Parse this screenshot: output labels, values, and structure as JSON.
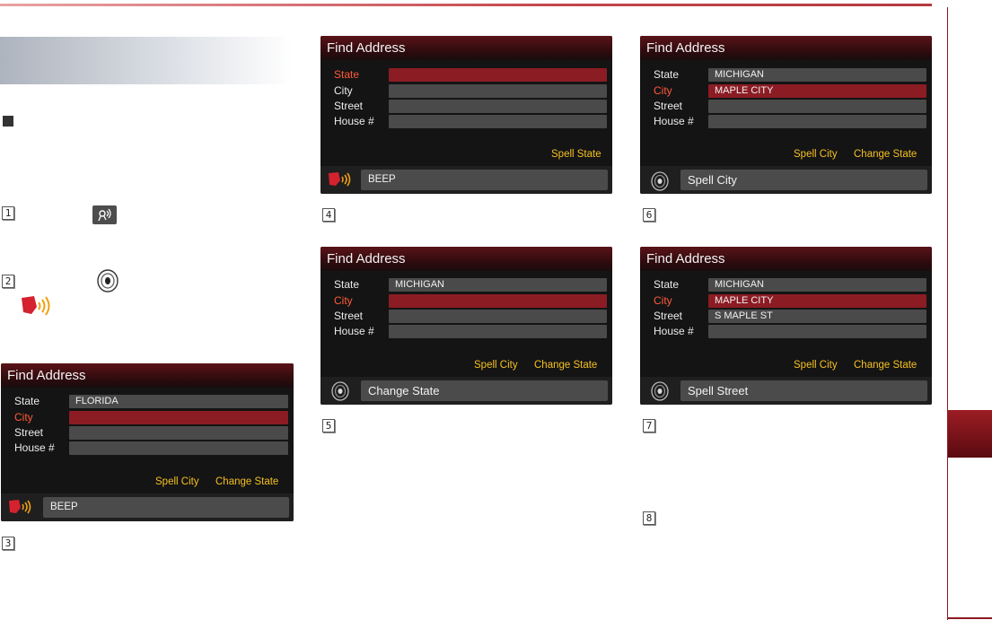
{
  "screens": {
    "s3": {
      "title": "Find Address",
      "labels": [
        "State",
        "City",
        "Street",
        "House #"
      ],
      "state_value": "FLORIDA",
      "softkeys": [
        "Spell City",
        "Change State"
      ],
      "status": "BEEP",
      "status_icon": "mic-speaking-icon"
    },
    "s4": {
      "title": "Find Address",
      "labels": [
        "State",
        "City",
        "Street",
        "House #"
      ],
      "softkeys": [
        "Spell State"
      ],
      "status": "BEEP",
      "status_icon": "mic-speaking-icon"
    },
    "s5": {
      "title": "Find Address",
      "labels": [
        "State",
        "City",
        "Street",
        "House #"
      ],
      "state_value": "MICHIGAN",
      "softkeys": [
        "Spell City",
        "Change State"
      ],
      "status": "Change State",
      "status_icon": "speaker-icon"
    },
    "s6": {
      "title": "Find Address",
      "labels": [
        "State",
        "City",
        "Street",
        "House #"
      ],
      "state_value": "MICHIGAN",
      "city_value": "MAPLE CITY",
      "softkeys": [
        "Spell City",
        "Change State"
      ],
      "status": "Spell City",
      "status_icon": "speaker-icon"
    },
    "s7": {
      "title": "Find Address",
      "labels": [
        "State",
        "City",
        "Street",
        "House #"
      ],
      "state_value": "MICHIGAN",
      "city_value": "MAPLE CITY",
      "street_value": "S MAPLE ST",
      "softkeys": [
        "Spell City",
        "Change State"
      ],
      "status": "Spell Street",
      "status_icon": "speaker-icon"
    }
  },
  "steps": [
    "1",
    "2",
    "3",
    "4",
    "5",
    "6",
    "7",
    "8"
  ],
  "colors": {
    "accent": "#8c1c24",
    "softkey": "#f5c020",
    "active_label": "#ff5a3a",
    "rule": "#8a1a1f"
  }
}
